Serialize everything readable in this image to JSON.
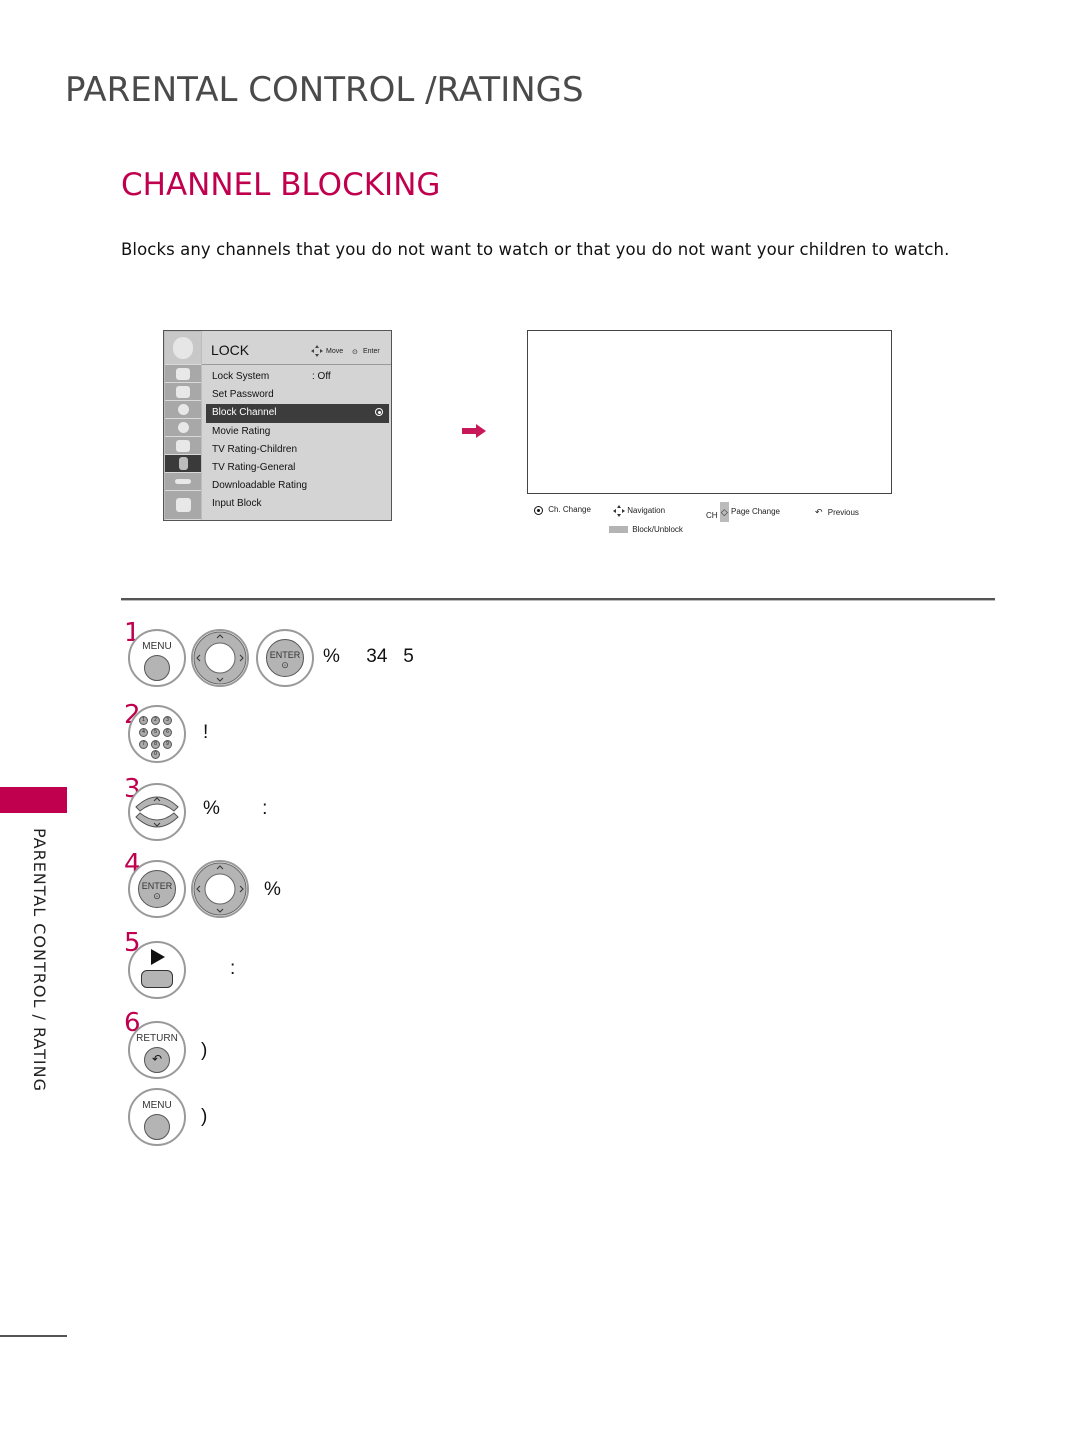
{
  "page": {
    "title": "PARENTAL CONTROL /RATINGS",
    "section_title": "CHANNEL BLOCKING",
    "intro": "Blocks any channels that you do not want to watch or that you do not want your children to watch.",
    "side_label": "PARENTAL CONTROL / RATING",
    "accent_color": "#c0004e"
  },
  "tv_menu": {
    "title": "LOCK",
    "hint_move": "Move",
    "hint_enter": "Enter",
    "items": [
      {
        "label": "Lock System",
        "value": ": Off"
      },
      {
        "label": "Set Password",
        "value": ""
      },
      {
        "label": "Block Channel",
        "value": "",
        "selected": true
      },
      {
        "label": "Movie Rating",
        "value": ""
      },
      {
        "label": "TV Rating-Children",
        "value": ""
      },
      {
        "label": "TV Rating-General",
        "value": ""
      },
      {
        "label": "Downloadable Rating",
        "value": ""
      },
      {
        "label": "Input Block",
        "value": ""
      }
    ],
    "side_icons": [
      "setup-icon",
      "video-icon",
      "audio-icon",
      "time-icon",
      "option-icon",
      "lock-icon",
      "input-icon",
      "usb-icon"
    ]
  },
  "channel_screen": {
    "legend": {
      "ch_change": "Ch. Change",
      "navigation": "Navigation",
      "ch_prefix": "CH",
      "page_change": "Page Change",
      "previous": "Previous",
      "block_unblock": "Block/Unblock"
    }
  },
  "steps": [
    {
      "number": "1",
      "buttons": [
        "MENU",
        "nav",
        "ENTER"
      ],
      "text": "%     34   5"
    },
    {
      "number": "2",
      "buttons": [
        "numpad"
      ],
      "text": "!"
    },
    {
      "number": "3",
      "buttons": [
        "updown"
      ],
      "text": "%        :"
    },
    {
      "number": "4",
      "buttons": [
        "ENTER",
        "nav"
      ],
      "text": "%"
    },
    {
      "number": "5",
      "buttons": [
        "play"
      ],
      "text": ":"
    },
    {
      "number": "6",
      "buttons": [
        "RETURN"
      ],
      "text": ")"
    },
    {
      "number": "",
      "buttons": [
        "MENU"
      ],
      "text": ")"
    }
  ],
  "button_labels": {
    "menu": "MENU",
    "enter": "ENTER",
    "return": "RETURN"
  },
  "numpad_keys": [
    "1",
    "2",
    "3",
    "4",
    "5",
    "6",
    "7",
    "8",
    "9",
    "0"
  ]
}
